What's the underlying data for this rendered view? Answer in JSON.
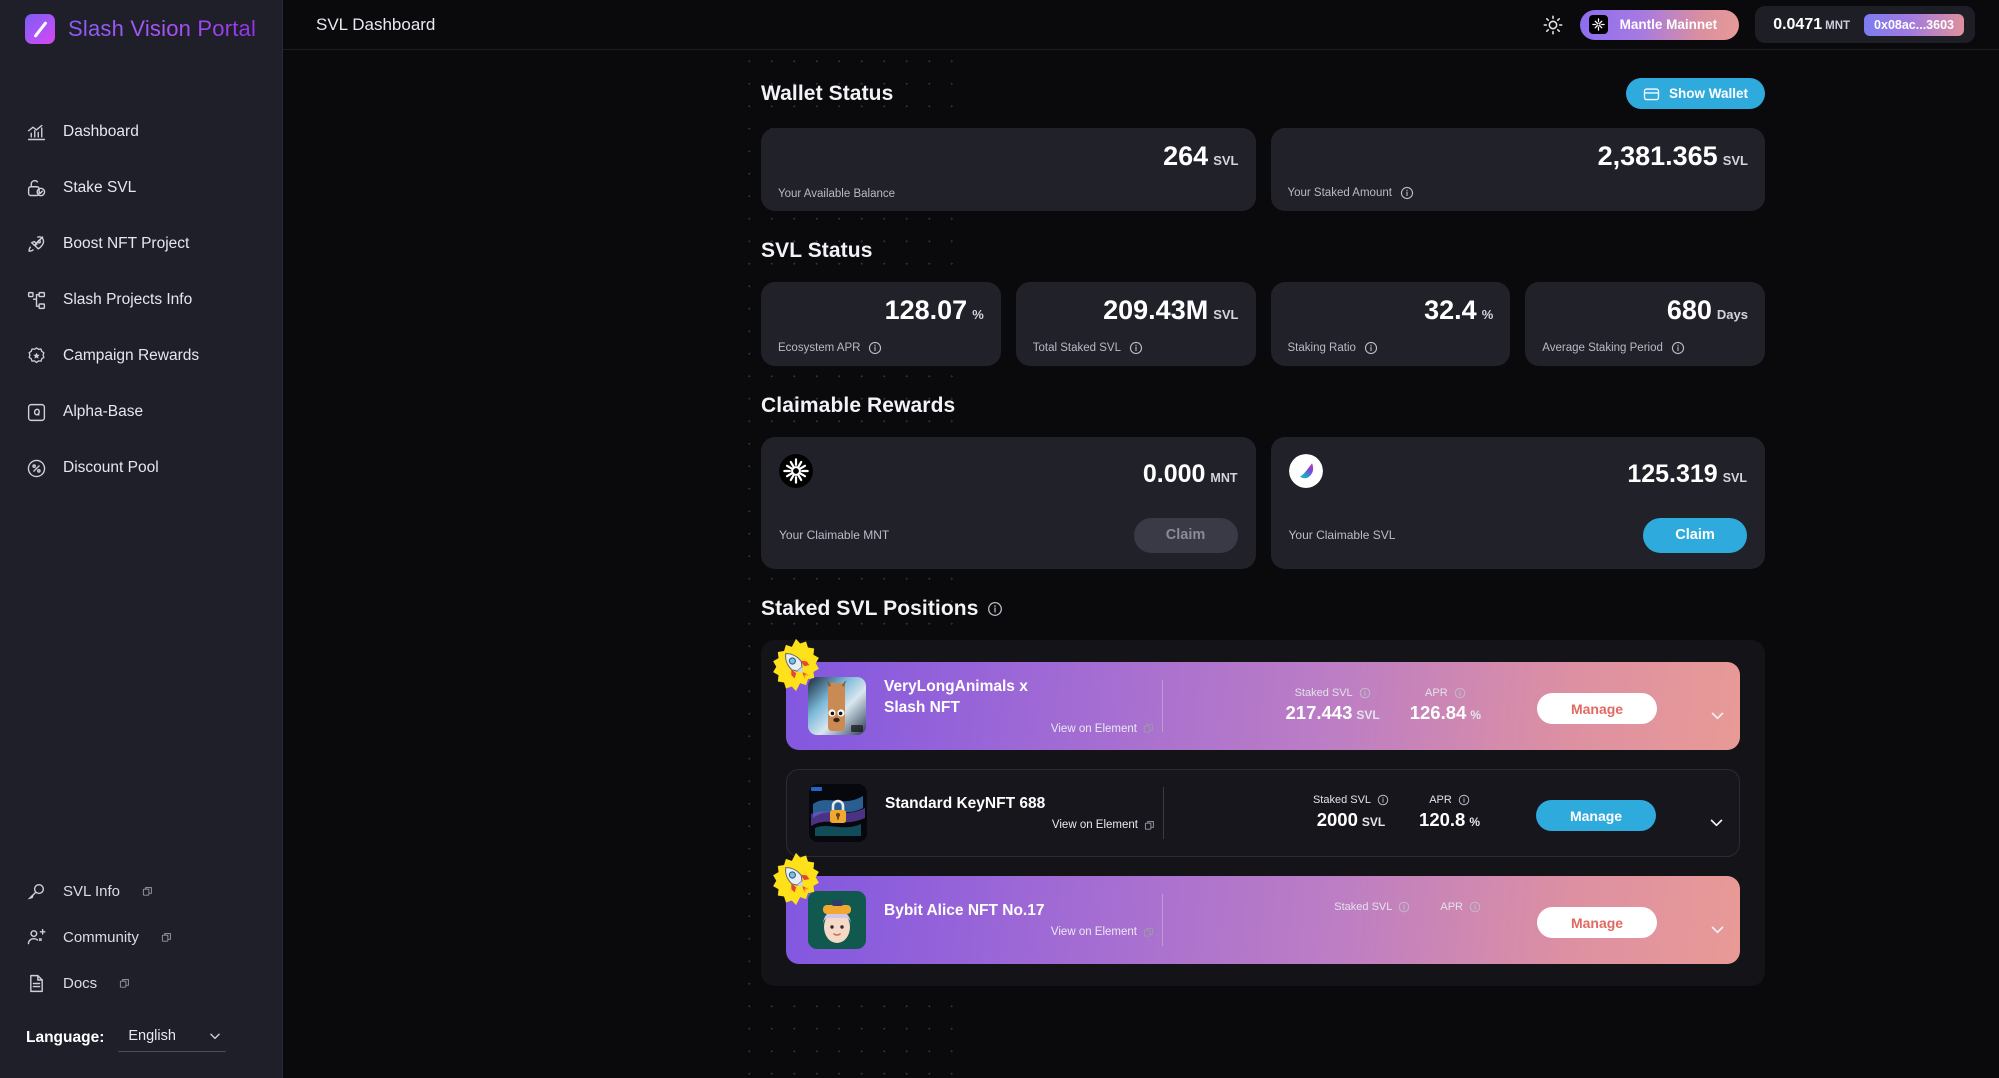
{
  "brand": {
    "name": "Slash Vision Portal",
    "logo_icon": "slash-logo-icon"
  },
  "sidebar": {
    "items": [
      {
        "label": "Dashboard",
        "icon": "chart-line-icon"
      },
      {
        "label": "Stake SVL",
        "icon": "lock-check-icon"
      },
      {
        "label": "Boost NFT Project",
        "icon": "rocket-icon"
      },
      {
        "label": "Slash Projects Info",
        "icon": "sitemap-icon"
      },
      {
        "label": "Campaign Rewards",
        "icon": "badge-star-icon"
      },
      {
        "label": "Alpha-Base",
        "icon": "alpha-square-icon"
      },
      {
        "label": "Discount Pool",
        "icon": "percent-circle-icon"
      }
    ],
    "bottom_links": [
      {
        "label": "SVL Info",
        "icon": "bulb-icon",
        "external": true
      },
      {
        "label": "Community",
        "icon": "users-add-icon",
        "external": true
      },
      {
        "label": "Docs",
        "icon": "document-icon",
        "external": true
      }
    ],
    "language": {
      "label": "Language:",
      "value": "English",
      "options": [
        "English"
      ]
    }
  },
  "topbar": {
    "title": "SVL Dashboard",
    "theme_toggle_icon": "sun-icon",
    "network": {
      "name": "Mantle Mainnet",
      "logo_icon": "mantle-logo-icon"
    },
    "wallet": {
      "balance": "0.0471",
      "balance_unit": "MNT",
      "address": "0x08ac...3603"
    }
  },
  "wallet_status": {
    "title": "Wallet Status",
    "show_wallet_label": "Show Wallet",
    "show_wallet_icon": "wallet-icon",
    "cards": [
      {
        "value": "264",
        "unit": "SVL",
        "label": "Your Available Balance",
        "has_info": false
      },
      {
        "value": "2,381.365",
        "unit": "SVL",
        "label": "Your Staked Amount",
        "has_info": true
      }
    ]
  },
  "svl_status": {
    "title": "SVL Status",
    "cards": [
      {
        "value": "128.07",
        "unit": "%",
        "label": "Ecosystem APR",
        "has_info": true
      },
      {
        "value": "209.43M",
        "unit": "SVL",
        "label": "Total Staked SVL",
        "has_info": true
      },
      {
        "value": "32.4",
        "unit": "%",
        "label": "Staking Ratio",
        "has_info": true
      },
      {
        "value": "680",
        "unit": "Days",
        "label": "Average Staking Period",
        "has_info": true
      }
    ]
  },
  "claimable_rewards": {
    "title": "Claimable Rewards",
    "cards": [
      {
        "token_icon": "mantle-token-icon",
        "amount": "0.000",
        "unit": "MNT",
        "label": "Your Claimable MNT",
        "button_label": "Claim",
        "button_state": "disabled"
      },
      {
        "token_icon": "svl-token-icon",
        "amount": "125.319",
        "unit": "SVL",
        "label": "Your Claimable SVL",
        "button_label": "Claim",
        "button_state": "active"
      }
    ]
  },
  "staked_positions": {
    "title": "Staked SVL Positions",
    "has_info": true,
    "column_labels": {
      "staked": "Staked SVL",
      "apr": "APR"
    },
    "view_link_label": "View on Element",
    "rows": [
      {
        "name": "VeryLongAnimals x Slash NFT",
        "name_line1": "VeryLongAnimals x",
        "name_line2": "Slash NFT",
        "staked": "217.443",
        "staked_unit": "SVL",
        "apr": "126.84",
        "apr_unit": "%",
        "manage_label": "Manage",
        "boosted": true,
        "style": "gradient",
        "thumb": "verylonganimals-thumb"
      },
      {
        "name": "Standard KeyNFT 688",
        "name_line1": "Standard KeyNFT 688",
        "name_line2": "",
        "staked": "2000",
        "staked_unit": "SVL",
        "apr": "120.8",
        "apr_unit": "%",
        "manage_label": "Manage",
        "boosted": false,
        "style": "dark",
        "thumb": "keynft-thumb"
      },
      {
        "name": "Bybit Alice NFT No.17",
        "name_line1": "Bybit Alice NFT No.17",
        "name_line2": "",
        "staked": "",
        "staked_unit": "",
        "apr": "",
        "apr_unit": "",
        "manage_label": "Manage",
        "boosted": true,
        "style": "gradient",
        "thumb": "bybit-alice-thumb"
      }
    ]
  },
  "colors": {
    "accent_cyan": "#2faadd",
    "brand_purple": "#8b5cf6",
    "card_bg": "#212129",
    "sidebar_bg": "#1f1f29",
    "page_bg": "#0a0a0c"
  }
}
